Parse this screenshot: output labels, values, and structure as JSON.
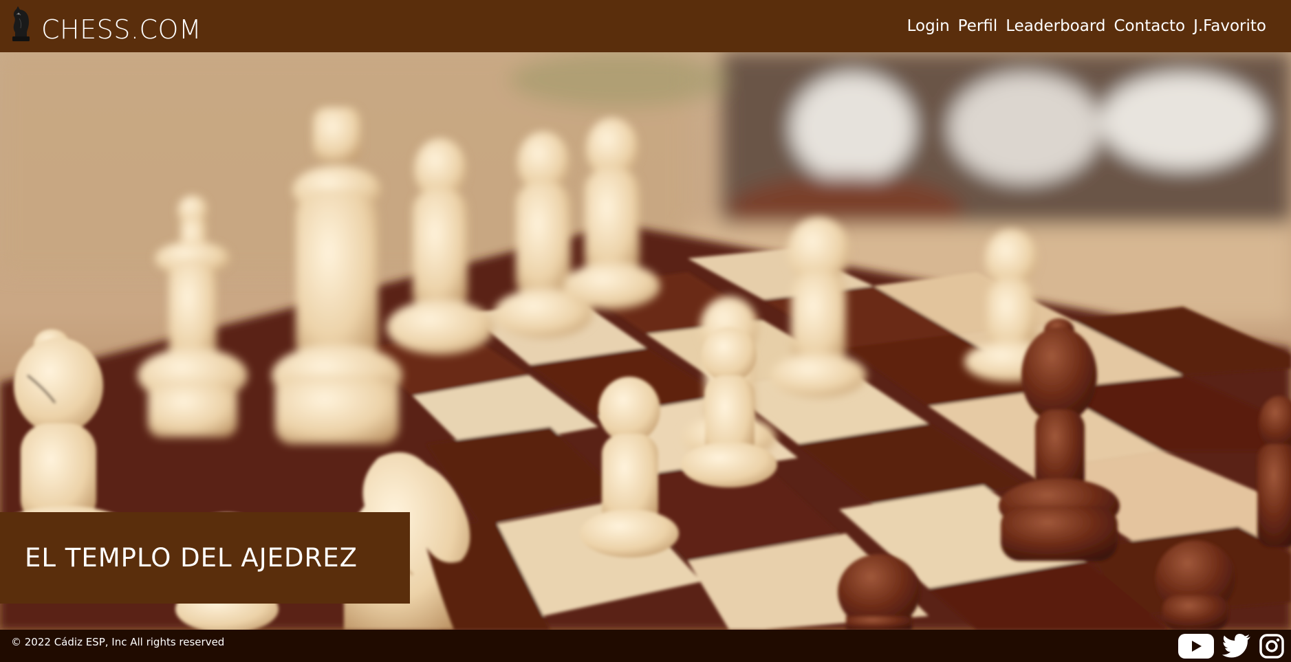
{
  "header": {
    "logo_icon": "knight-icon",
    "brand": "CHESS.COM",
    "nav": [
      {
        "label": "Login"
      },
      {
        "label": "Perfil"
      },
      {
        "label": "Leaderboard"
      },
      {
        "label": "Contacto"
      },
      {
        "label": "J.Favorito"
      }
    ]
  },
  "hero": {
    "image": "chessboard-photo",
    "banner_title": "EL TEMPLO DEL AJEDREZ"
  },
  "footer": {
    "copyright": "© 2022 Cádiz ESP, Inc All rights reserved",
    "social": [
      {
        "icon": "youtube-icon"
      },
      {
        "icon": "twitter-icon"
      },
      {
        "icon": "instagram-icon"
      }
    ]
  },
  "colors": {
    "header_bg": "#5a2e0c",
    "banner_bg": "#5a2e0c",
    "footer_bg": "#200b00",
    "text": "#ffffff"
  }
}
